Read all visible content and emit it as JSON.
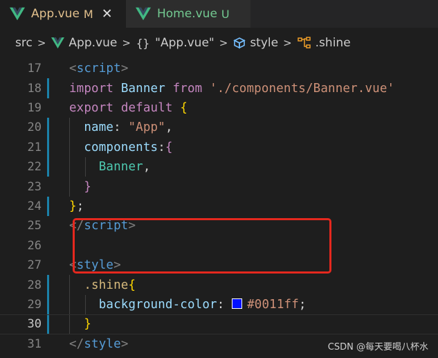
{
  "tabs": [
    {
      "label": "App.vue",
      "status": "M",
      "active": true,
      "close_glyph": "✕"
    },
    {
      "label": "Home.vue",
      "status": "U",
      "active": false
    }
  ],
  "breadcrumb": {
    "folder": "src",
    "file": "App.vue",
    "braces": "{}",
    "block": "\"App.vue\"",
    "style": "style",
    "selector": ".shine",
    "separator": ">"
  },
  "editor": {
    "lines": [
      {
        "n": "17",
        "tokens": [
          [
            "punct",
            "<"
          ],
          [
            "tag",
            "script"
          ],
          [
            "punct",
            ">"
          ]
        ]
      },
      {
        "n": "18",
        "tokens": [
          [
            "kw",
            "import"
          ],
          [
            "plain",
            " "
          ],
          [
            "var",
            "Banner"
          ],
          [
            "plain",
            " "
          ],
          [
            "kw",
            "from"
          ],
          [
            "plain",
            " "
          ],
          [
            "str",
            "'./components/Banner.vue'"
          ]
        ]
      },
      {
        "n": "19",
        "tokens": [
          [
            "kw",
            "export"
          ],
          [
            "plain",
            " "
          ],
          [
            "kw",
            "default"
          ],
          [
            "plain",
            " "
          ],
          [
            "bracket",
            "{"
          ]
        ]
      },
      {
        "n": "20",
        "tokens": [
          [
            "plain",
            "  "
          ],
          [
            "name",
            "name"
          ],
          [
            "plain",
            ": "
          ],
          [
            "str",
            "\"App\""
          ],
          [
            "plain",
            ","
          ]
        ]
      },
      {
        "n": "21",
        "tokens": [
          [
            "plain",
            "  "
          ],
          [
            "name",
            "components"
          ],
          [
            "plain",
            ":"
          ],
          [
            "bracket2",
            "{"
          ]
        ]
      },
      {
        "n": "22",
        "tokens": [
          [
            "plain",
            "    "
          ],
          [
            "cls",
            "Banner"
          ],
          [
            "plain",
            ","
          ]
        ]
      },
      {
        "n": "23",
        "tokens": [
          [
            "plain",
            "  "
          ],
          [
            "bracket2",
            "}"
          ]
        ]
      },
      {
        "n": "24",
        "tokens": [
          [
            "bracket",
            "}"
          ],
          [
            "plain",
            ";"
          ]
        ]
      },
      {
        "n": "25",
        "tokens": [
          [
            "punct",
            "</"
          ],
          [
            "tag",
            "script"
          ],
          [
            "punct",
            ">"
          ]
        ]
      },
      {
        "n": "26",
        "tokens": []
      },
      {
        "n": "27",
        "tokens": [
          [
            "punct",
            "<"
          ],
          [
            "tag",
            "style"
          ],
          [
            "punct",
            ">"
          ]
        ]
      },
      {
        "n": "28",
        "tokens": [
          [
            "plain",
            "  "
          ],
          [
            "sel",
            ".shine"
          ],
          [
            "bracket",
            "{"
          ]
        ]
      },
      {
        "n": "29",
        "tokens": [
          [
            "plain",
            "    "
          ],
          [
            "prop",
            "background-color"
          ],
          [
            "plain",
            ": "
          ],
          [
            "swatch",
            ""
          ],
          [
            "val",
            "#0011ff"
          ],
          [
            "plain",
            ";"
          ]
        ]
      },
      {
        "n": "30",
        "tokens": [
          [
            "plain",
            "  "
          ],
          [
            "bracket",
            "}"
          ]
        ]
      },
      {
        "n": "31",
        "tokens": [
          [
            "punct",
            "</"
          ],
          [
            "tag",
            "style"
          ],
          [
            "punct",
            ">"
          ]
        ]
      }
    ],
    "modified_lines": [
      "18",
      "20",
      "21",
      "22",
      "24",
      "28",
      "29",
      "30"
    ],
    "current_line": "30"
  },
  "colors": {
    "swatch": "#0011ff",
    "highlight": "#e5281e",
    "vue_green": "#41b883",
    "vue_dark": "#35495e"
  },
  "watermark": "CSDN @每天要喝八杯水"
}
